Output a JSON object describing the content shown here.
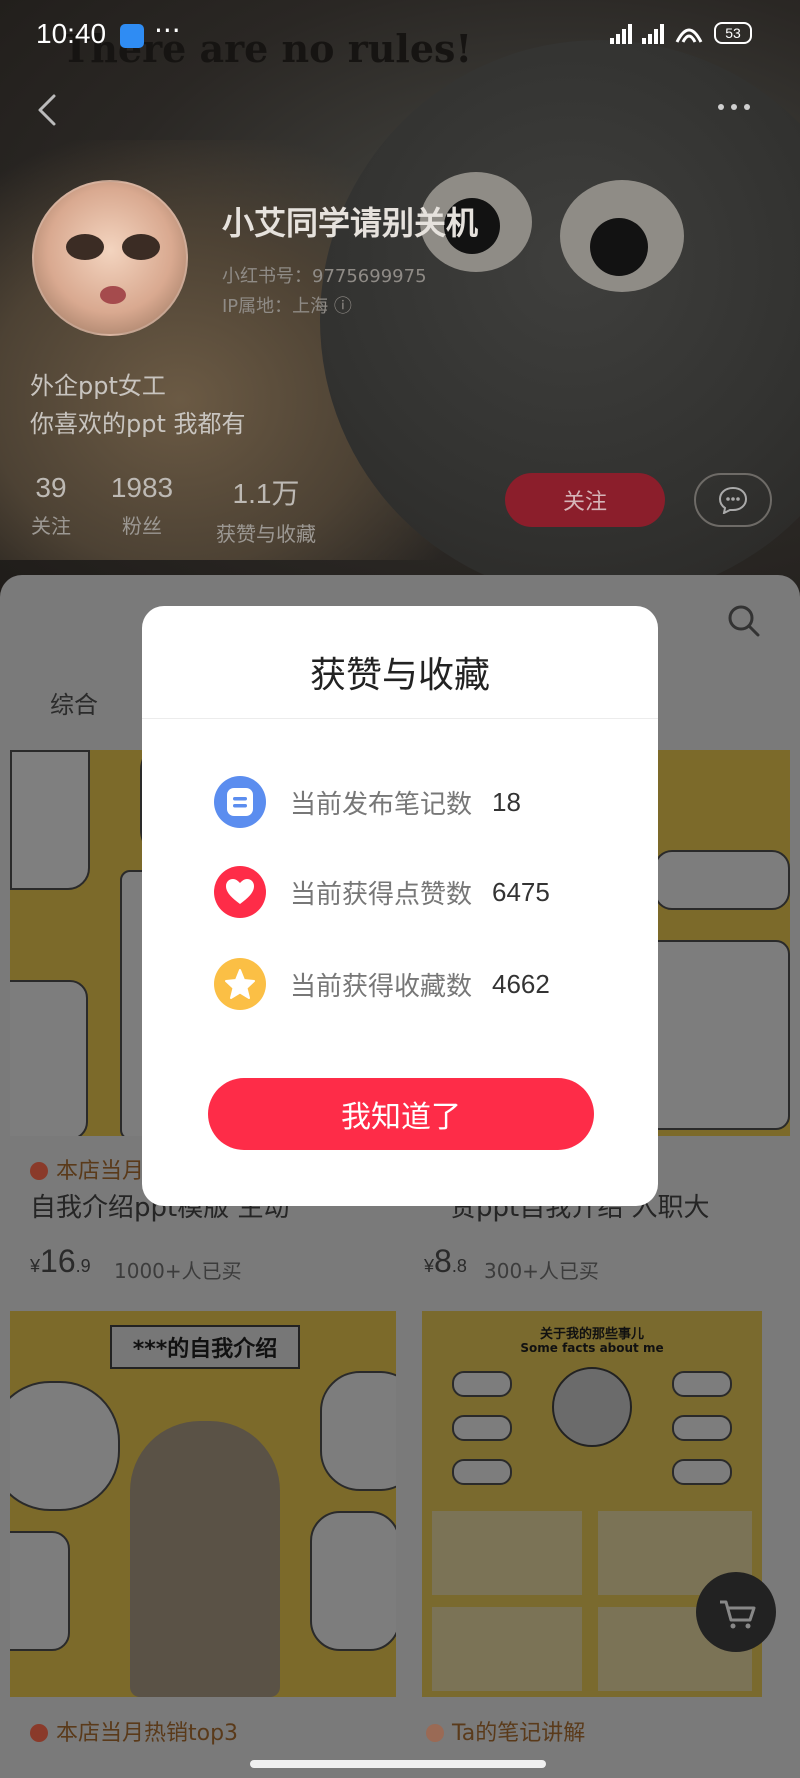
{
  "status_bar": {
    "time": "10:40",
    "dots": "···",
    "battery": "53"
  },
  "hero": {
    "tagline": "There are no rules!"
  },
  "profile": {
    "nickname": "小艾同学请别关机",
    "red_id": "小红书号：9775699975",
    "ip_location": "IP属地：上海 ⓘ",
    "bio_line1": "外企ppt女工",
    "bio_line2": "你喜欢的ppt 我都有",
    "stats": [
      {
        "value": "39",
        "label": "关注"
      },
      {
        "value": "1983",
        "label": "粉丝"
      },
      {
        "value": "1.1万",
        "label": "获赞与收藏"
      }
    ],
    "follow_label": "关注"
  },
  "content": {
    "filter_chip": "综合",
    "cards": [
      {
        "title": "自我介绍ppt模版 生动",
        "price_int": "16",
        "price_dec": ".9",
        "currency": "¥",
        "sold": "1000+人已买",
        "tag": "本店当月"
      },
      {
        "title": "贫ppt自我介绍 入职大",
        "price_int": "8",
        "price_dec": ".8",
        "currency": "¥",
        "sold": "300+人已买"
      },
      {
        "title": "***的自我介绍",
        "tag": "本店当月热销top3"
      },
      {
        "title": "关于我的那些事儿",
        "subtitle": "Some facts about me",
        "tag": "Ta的笔记讲解"
      }
    ]
  },
  "modal": {
    "title": "获赞与收藏",
    "rows": [
      {
        "label": "当前发布笔记数",
        "value": "18",
        "icon": "note-icon",
        "color": "#5b8def"
      },
      {
        "label": "当前获得点赞数",
        "value": "6475",
        "icon": "heart-icon",
        "color": "#fe2c48"
      },
      {
        "label": "当前获得收藏数",
        "value": "4662",
        "icon": "star-icon",
        "color": "#fbbf45"
      }
    ],
    "button_label": "我知道了",
    "accent": "#fe2c48"
  }
}
